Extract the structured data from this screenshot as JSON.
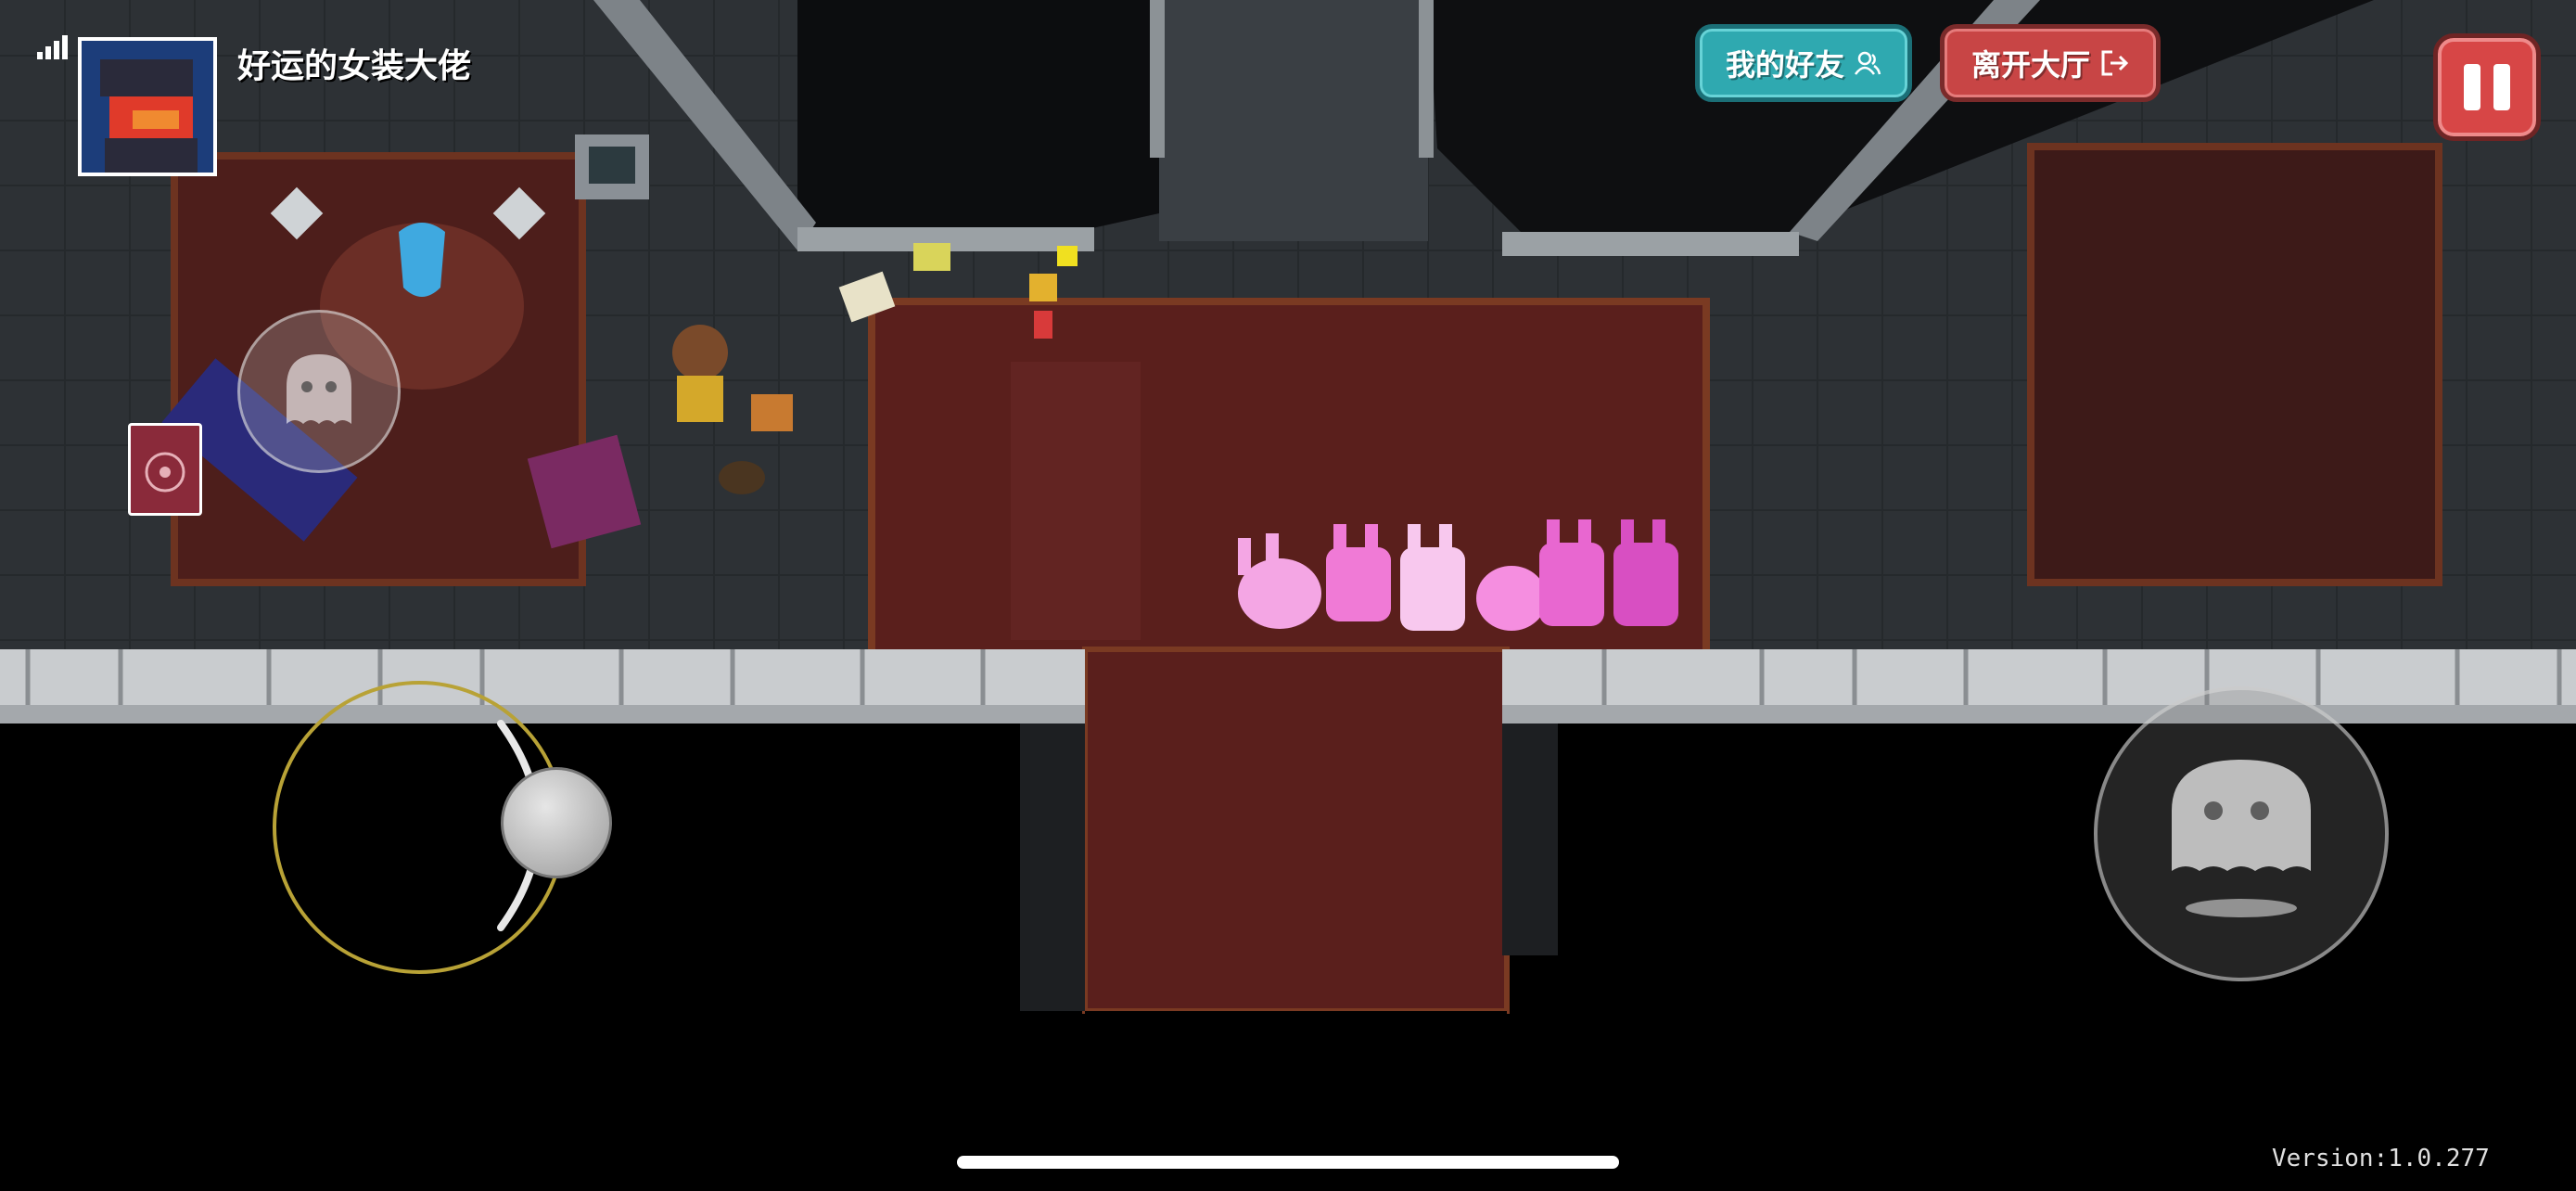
{
  "hud": {
    "player_name": "好运的女装大佬",
    "friends_label": "我的好友",
    "leave_label": "离开大厅",
    "version_text": "Version:1.0.277",
    "signal_bars": 4
  },
  "icons": {
    "friends": "friends-icon",
    "leave": "exit-arrow-icon",
    "pause": "pause-icon",
    "attack": "ghost-attack-icon",
    "skill": "ghost-skill-icon"
  },
  "colors": {
    "friends_button": "#2fa9b0",
    "leave_button": "#c84545",
    "pause_button": "#d74646",
    "joystick_ring": "#b8a236",
    "carpet": "#5a1f1c",
    "floor": "#2d3135",
    "wall_stone": "#c9cccf",
    "bunny_pink": "#f07ad6"
  }
}
